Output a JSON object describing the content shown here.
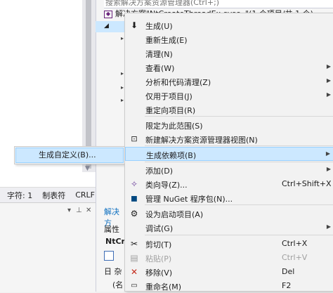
{
  "search": {
    "placeholder": "搜索解决方案资源管理器(Ctrl+;)"
  },
  "solution": {
    "label": "解决方案\"NtCreateThreadEx-sysc..\"(1 个项目/共 1 个)"
  },
  "statusbar": {
    "chars": "字符: 1",
    "tabs": "制表符",
    "eol": "CRLF"
  },
  "side_panel": {
    "tab_label": "解决方",
    "props_title": "属性",
    "props_object": "NtCr",
    "props_row1": "日 杂",
    "props_row2": "(名"
  },
  "submenu": {
    "item": "生成自定义(B)..."
  },
  "menu": {
    "build": "生成(U)",
    "rebuild": "重新生成(E)",
    "clean": "清理(N)",
    "view": "查看(W)",
    "analyze": "分析和代码清理(Z)",
    "project_only": "仅用于项目(J)",
    "retarget": "重定向项目(R)",
    "scope_to_this": "限定为此范围(S)",
    "new_view": "新建解决方案资源管理器视图(N)",
    "build_dependencies": "生成依赖项(B)",
    "add": "添加(D)",
    "class_wizard": "类向导(Z)...",
    "class_wizard_shortcut": "Ctrl+Shift+X",
    "nuget": "管理 NuGet 程序包(N)...",
    "set_startup": "设为启动项目(A)",
    "debug": "调试(G)",
    "cut": "剪切(T)",
    "cut_shortcut": "Ctrl+X",
    "paste": "粘贴(P)",
    "paste_shortcut": "Ctrl+V",
    "remove": "移除(V)",
    "remove_shortcut": "Del",
    "rename": "重命名(M)",
    "rename_shortcut": "F2"
  },
  "icons": {
    "build": "build-icon",
    "new_view": "explorer-view-icon",
    "class_wizard": "class-wizard-icon",
    "nuget": "nuget-icon",
    "startup": "gear-icon",
    "cut": "scissors-icon",
    "paste": "clipboard-icon",
    "remove": "red-x-icon",
    "rename": "rename-icon"
  },
  "colors": {
    "highlight": "#cce8ff",
    "highlight_border": "#99d1ff",
    "menu_bg": "#f2f2f2",
    "remove_red": "#c42b1c",
    "link_blue": "#0e70c0"
  }
}
